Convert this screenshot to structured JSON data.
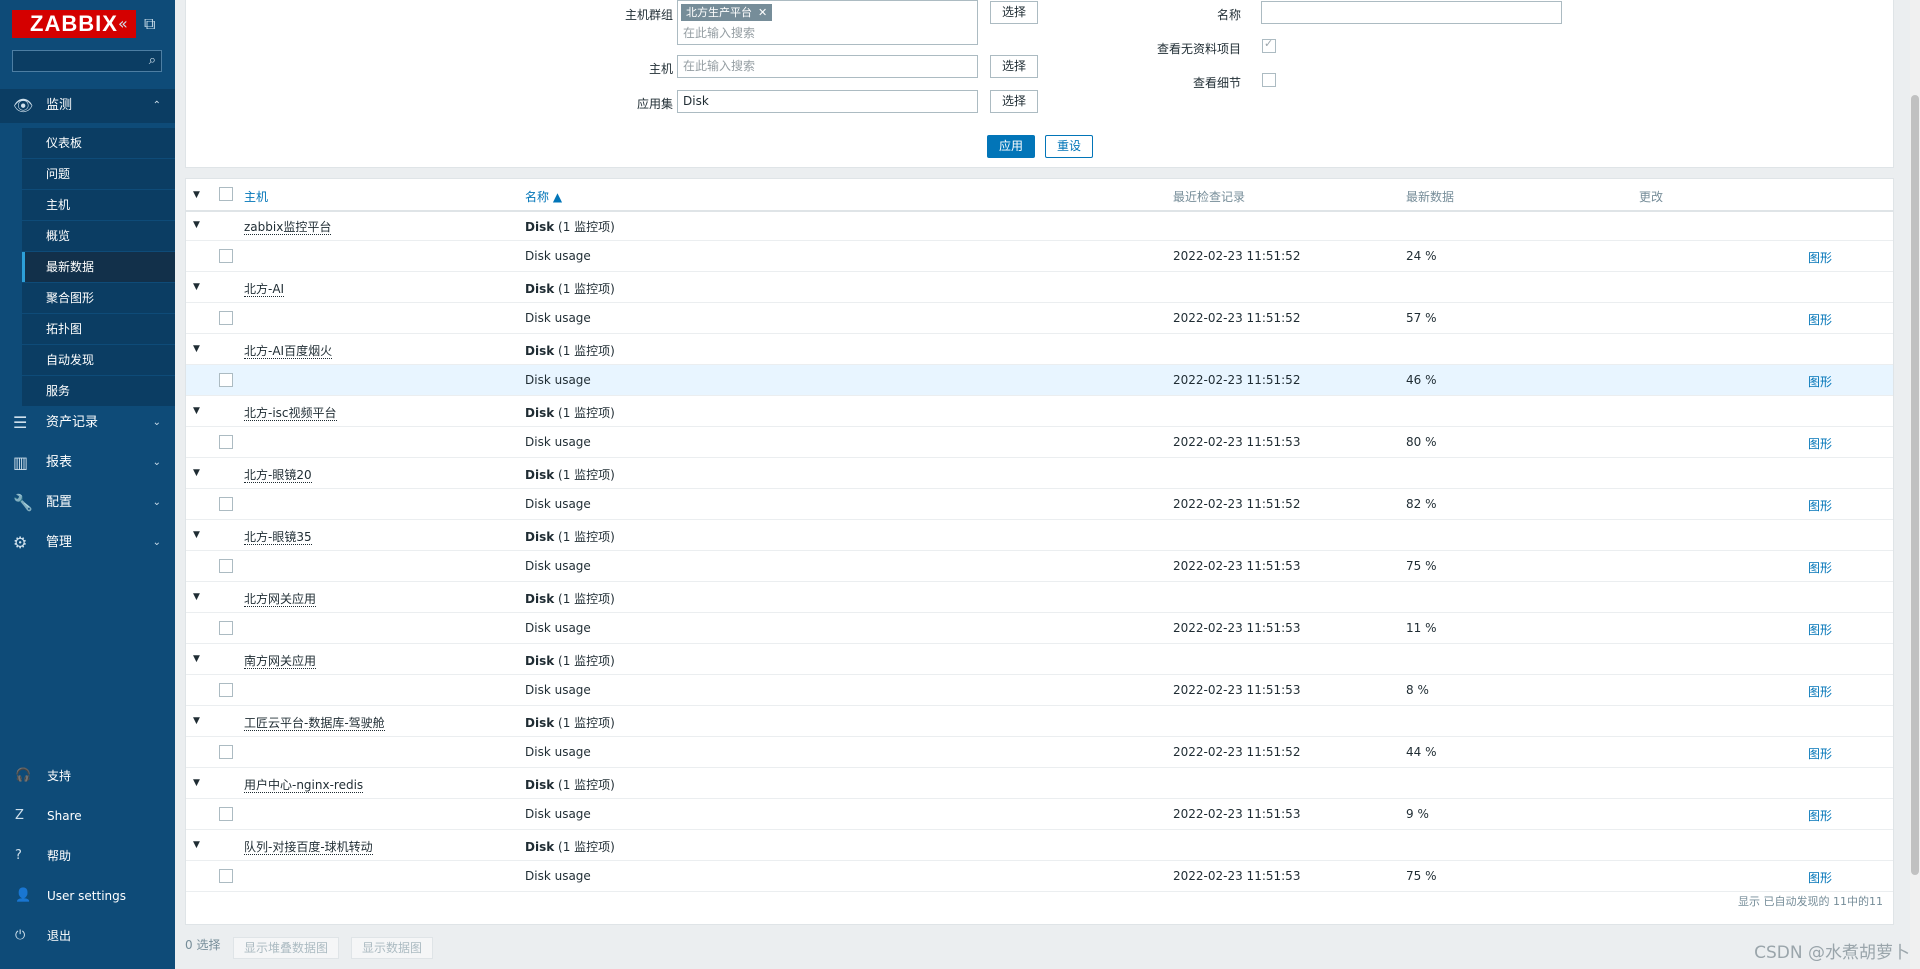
{
  "sidebar": {
    "logo": "ZABBIX",
    "collapse_icon": "«",
    "kiosk_icon": "⧉",
    "search_icon": "⌕",
    "sections": {
      "monitoring": {
        "label": "监测",
        "icon": "eye-icon",
        "glyph": "👁",
        "chev": "⌃"
      },
      "inventory": {
        "label": "资产记录",
        "glyph": "☰",
        "chev": "⌄"
      },
      "reports": {
        "label": "报表",
        "glyph": "▥",
        "chev": "⌄"
      },
      "configuration": {
        "label": "配置",
        "glyph": "🔧",
        "chev": "⌄"
      },
      "administration": {
        "label": "管理",
        "glyph": "⚙",
        "chev": "⌄"
      }
    },
    "sub_items": [
      "仪表板",
      "问题",
      "主机",
      "概览",
      "最新数据",
      "聚合图形",
      "拓扑图",
      "自动发现",
      "服务"
    ],
    "footer": [
      {
        "label": "支持",
        "glyph": "🎧"
      },
      {
        "label": "Share",
        "glyph": "Z"
      },
      {
        "label": "帮助",
        "glyph": "?"
      },
      {
        "label": "User settings",
        "glyph": "👤"
      },
      {
        "label": "退出",
        "glyph": "⏻"
      }
    ]
  },
  "filter": {
    "host_groups_label": "主机群组",
    "host_group_tag": "北方生产平台",
    "tag_remove": "✕",
    "search_placeholder": "在此输入搜索",
    "hosts_label": "主机",
    "application_label": "应用集",
    "application_value": "Disk",
    "select_label": "选择",
    "name_label": "名称",
    "name_value": "",
    "show_items_without_data_label": "查看无资料项目",
    "show_details_label": "查看细节",
    "apply_label": "应用",
    "reset_label": "重设"
  },
  "table": {
    "headers": {
      "host": "主机",
      "name": "名称 ▲",
      "last_check": "最近检查记录",
      "last_value": "最新数据",
      "change": "更改"
    },
    "collapse_glyph": "▼",
    "groups": [
      {
        "host": "zabbix监控平台",
        "app": "Disk",
        "count": "(1 监控项)",
        "item": "Disk usage",
        "last_check": "2022-02-23 11:51:52",
        "value": "24 %",
        "graph": "图形"
      },
      {
        "host": "北方-AI",
        "app": "Disk",
        "count": "(1 监控项)",
        "item": "Disk usage",
        "last_check": "2022-02-23 11:51:52",
        "value": "57 %",
        "graph": "图形"
      },
      {
        "host": "北方-AI百度烟火",
        "app": "Disk",
        "count": "(1 监控项)",
        "item": "Disk usage",
        "last_check": "2022-02-23 11:51:52",
        "value": "46 %",
        "graph": "图形"
      },
      {
        "host": "北方-isc视频平台",
        "app": "Disk",
        "count": "(1 监控项)",
        "item": "Disk usage",
        "last_check": "2022-02-23 11:51:53",
        "value": "80 %",
        "graph": "图形"
      },
      {
        "host": "北方-眼镜20",
        "app": "Disk",
        "count": "(1 监控项)",
        "item": "Disk usage",
        "last_check": "2022-02-23 11:51:52",
        "value": "82 %",
        "graph": "图形"
      },
      {
        "host": "北方-眼镜35",
        "app": "Disk",
        "count": "(1 监控项)",
        "item": "Disk usage",
        "last_check": "2022-02-23 11:51:53",
        "value": "75 %",
        "graph": "图形"
      },
      {
        "host": "北方网关应用",
        "app": "Disk",
        "count": "(1 监控项)",
        "item": "Disk usage",
        "last_check": "2022-02-23 11:51:53",
        "value": "11 %",
        "graph": "图形"
      },
      {
        "host": "南方网关应用",
        "app": "Disk",
        "count": "(1 监控项)",
        "item": "Disk usage",
        "last_check": "2022-02-23 11:51:53",
        "value": "8 %",
        "graph": "图形"
      },
      {
        "host": "工匠云平台-数据库-驾驶舱",
        "app": "Disk",
        "count": "(1 监控项)",
        "item": "Disk usage",
        "last_check": "2022-02-23 11:51:52",
        "value": "44 %",
        "graph": "图形"
      },
      {
        "host": "用户中心-nginx-redis",
        "app": "Disk",
        "count": "(1 监控项)",
        "item": "Disk usage",
        "last_check": "2022-02-23 11:51:53",
        "value": "9 %",
        "graph": "图形"
      },
      {
        "host": "队列-对接百度-球机转动",
        "app": "Disk",
        "count": "(1 监控项)",
        "item": "Disk usage",
        "last_check": "2022-02-23 11:51:53",
        "value": "75 %",
        "graph": "图形"
      }
    ],
    "displaying": "显示 已自动发现的 11中的11"
  },
  "bottom": {
    "selected": "0 选择",
    "stacked_graph": "显示堆叠数据图",
    "graph": "显示数据图"
  },
  "watermark": "CSDN @水煮胡萝卜",
  "colors": {
    "sidebar": "#0e4b78",
    "accent": "#0275b8",
    "logo": "#d40000"
  }
}
